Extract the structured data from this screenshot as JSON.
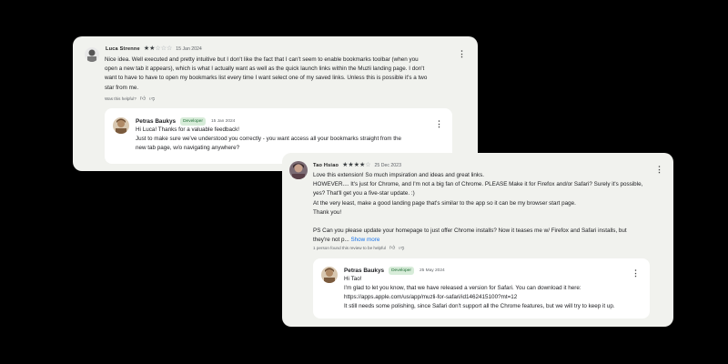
{
  "review1": {
    "author": "Luca Strenne",
    "rating": 2,
    "date": "15 Jan 2024",
    "body_lines": [
      "Nice idea. Well executed and pretty intuitive but I don't like the fact that I can't seem to enable bookmarks toolbar (when you",
      "open a new tab it appears), which is what I actually want as well as the quick launch links within the Muzli landing page. I don't",
      "want to have to have to open my bookmarks list every time I want select one of my saved links. Unless this is possible it's a two",
      "star from me."
    ],
    "helpful_label": "Was this helpful?",
    "reply": {
      "author": "Petras Baukys",
      "badge": "Developer",
      "date": "15 Jan 2024",
      "lines": [
        "Hi Luca! Thanks for a valuable feedback!",
        "Just to make sure we've understood you correctly - you want access all your bookmarks straight from the",
        "new tab page, w/o navigating anywhere?"
      ]
    }
  },
  "review2": {
    "author": "Tao Hsiao",
    "rating": 4,
    "date": "25 Dec 2023",
    "body_lines": [
      "Love this extension! So much impsiration and ideas and great links.",
      "HOWEVER.... It's just for Chrome, and I'm not a big fan of Chrome. PLEASE Make it for Firefox and/or Safari? Surely it's possible,",
      "yes? That'll get you a five-star update. :)",
      "At the very least, make a good landing page that's similar to the app so it can be my browser start page.",
      "Thank you!",
      "",
      "PS Can you please update your homepage to just offer Chrome installs? Now it teases me w/ Firefox and Safari installs, but"
    ],
    "last_line": "they're not p...",
    "show_more": "Show more",
    "helpful_label": "1 person found this review to be helpful",
    "reply": {
      "author": "Petras Baukys",
      "badge": "Developer",
      "date": "25 May 2024",
      "lines": [
        "Hi Tao!",
        "I'm glad to let you know, that we have released a version for Safari. You can download it here:",
        "https://apps.apple.com/us/app/muzli-for-safari/id1462415100?mt=12",
        "It still needs some polishing, since Safari don't support all the Chrome features, but we will try to keep it up."
      ]
    }
  }
}
